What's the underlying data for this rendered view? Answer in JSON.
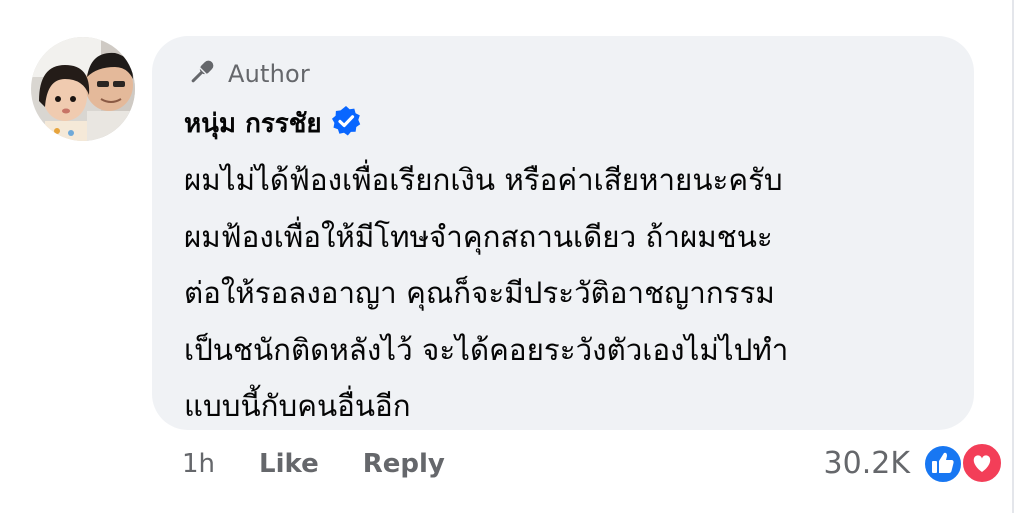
{
  "comment": {
    "badge_label": "Author",
    "author_name": "หนุ่ม กรรชัย",
    "verified": true,
    "text_lines": [
      "ผมไม่ได้ฟ้องเพื่อเรียกเงิน หรือค่าเสียหายนะครับ",
      "ผมฟ้องเพื่อให้มีโทษจำคุกสถานเดียว ถ้าผมชนะ",
      "ต่อให้รอลงอาญา คุณก็จะมีประวัติอาชญากรรม",
      "เป็นชนักติดหลังไว้ จะได้คอยระวังตัวเองไม่ไปทำ",
      "แบบนี้กับคนอื่นอีก"
    ]
  },
  "actions": {
    "timestamp": "1h",
    "like_label": "Like",
    "reply_label": "Reply"
  },
  "reactions": {
    "count": "30.2K",
    "types": [
      "like-icon",
      "love-icon"
    ]
  },
  "colors": {
    "bubble_bg": "#f0f2f5",
    "secondary_text": "#65676b",
    "primary_text": "#050505",
    "verified_blue": "#0866ff",
    "like_blue": "#1877f2",
    "love_red": "#f33e58"
  }
}
